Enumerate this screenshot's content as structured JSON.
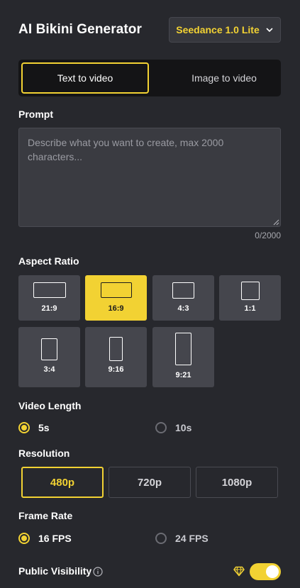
{
  "header": {
    "title": "AI Bikini Generator",
    "model_label": "Seedance 1.0 Lite"
  },
  "mode_tabs": [
    {
      "label": "Text to video",
      "active": true
    },
    {
      "label": "Image to video",
      "active": false
    }
  ],
  "prompt": {
    "label": "Prompt",
    "placeholder": "Describe what you want to create, max 2000 characters...",
    "value": "",
    "char_count": "0/2000"
  },
  "aspect_ratio": {
    "label": "Aspect Ratio",
    "options": [
      "21:9",
      "16:9",
      "4:3",
      "1:1",
      "3:4",
      "9:16",
      "9:21"
    ],
    "selected": "16:9"
  },
  "video_length": {
    "label": "Video Length",
    "options": [
      "5s",
      "10s"
    ],
    "selected": "5s"
  },
  "resolution": {
    "label": "Resolution",
    "options": [
      "480p",
      "720p",
      "1080p"
    ],
    "selected": "480p"
  },
  "frame_rate": {
    "label": "Frame Rate",
    "options": [
      "16 FPS",
      "24 FPS"
    ],
    "selected": "16 FPS"
  },
  "public_visibility": {
    "label": "Public Visibility",
    "enabled": true,
    "icons": [
      "info-icon",
      "gem-icon"
    ]
  },
  "colors": {
    "accent": "#f2d233",
    "background": "#27282d",
    "tile": "#45464d"
  }
}
